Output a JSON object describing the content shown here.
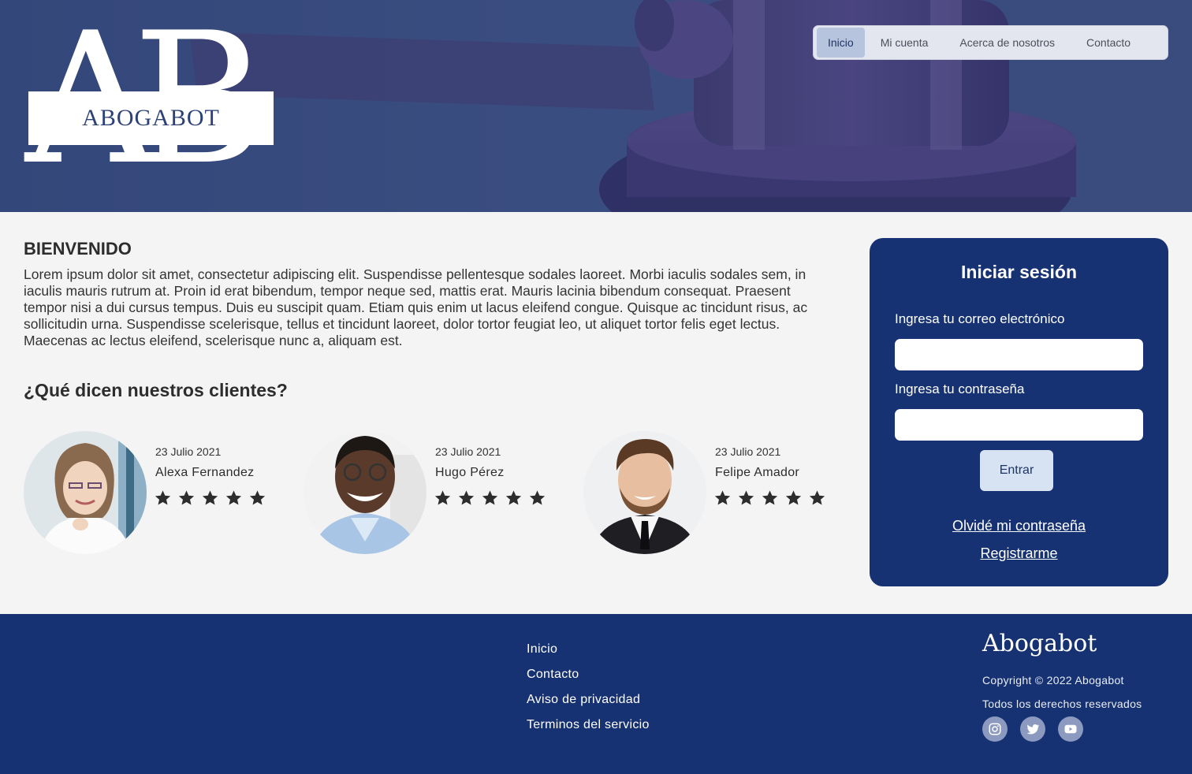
{
  "brand": {
    "logo_letters": "AB",
    "logo_text": "ABOGABOT"
  },
  "nav": {
    "items": [
      {
        "label": "Inicio",
        "active": true
      },
      {
        "label": "Mi cuenta",
        "active": false
      },
      {
        "label": "Acerca de nosotros",
        "active": false
      },
      {
        "label": "Contacto",
        "active": false
      }
    ]
  },
  "welcome": {
    "title": "BIENVENIDO",
    "text": "Lorem ipsum dolor sit amet, consectetur adipiscing elit. Suspendisse pellentesque sodales laoreet. Morbi iaculis sodales sem, in iaculis mauris rutrum at. Proin id erat bibendum, tempor neque sed, mattis erat. Mauris lacinia bibendum consequat. Praesent tempor nisi a dui cursus tempus. Duis eu suscipit quam. Etiam quis enim ut lacus eleifend congue. Quisque ac tincidunt risus, ac sollicitudin urna. Suspendisse scelerisque, tellus et tincidunt laoreet, dolor tortor feugiat leo, ut aliquet tortor felis eget lectus. Maecenas ac lectus eleifend, scelerisque nunc a, aliquam est."
  },
  "testimonials": {
    "title": "¿Qué dicen nuestros clientes?",
    "items": [
      {
        "date": "23 Julio 2021",
        "name": "Alexa Fernandez",
        "rating": 5
      },
      {
        "date": "23 Julio 2021",
        "name": "Hugo Pérez",
        "rating": 5
      },
      {
        "date": "23 Julio 2021",
        "name": "Felipe Amador",
        "rating": 5
      }
    ]
  },
  "login": {
    "title": "Iniciar sesión",
    "email_label": "Ingresa tu correo electrónico",
    "email_value": "",
    "password_label": "Ingresa tu contraseña",
    "password_value": "",
    "submit_label": "Entrar",
    "forgot_label": "Olvidé mi contraseña",
    "register_label": "Registrarme"
  },
  "footer": {
    "links": [
      "Inicio",
      "Contacto",
      "Aviso de privacidad",
      "Terminos del servicio"
    ],
    "brand": "Abogabot",
    "copyright": "Copyright © 2022 Abogabot",
    "rights": "Todos los derechos reservados",
    "social": [
      "instagram-icon",
      "twitter-icon",
      "youtube-icon"
    ]
  },
  "colors": {
    "primary": "#163272",
    "hero": "#3a4d80",
    "nav_active": "#b7c4dd",
    "button": "#d7e3f2",
    "page_bg": "#f4f4f4"
  }
}
